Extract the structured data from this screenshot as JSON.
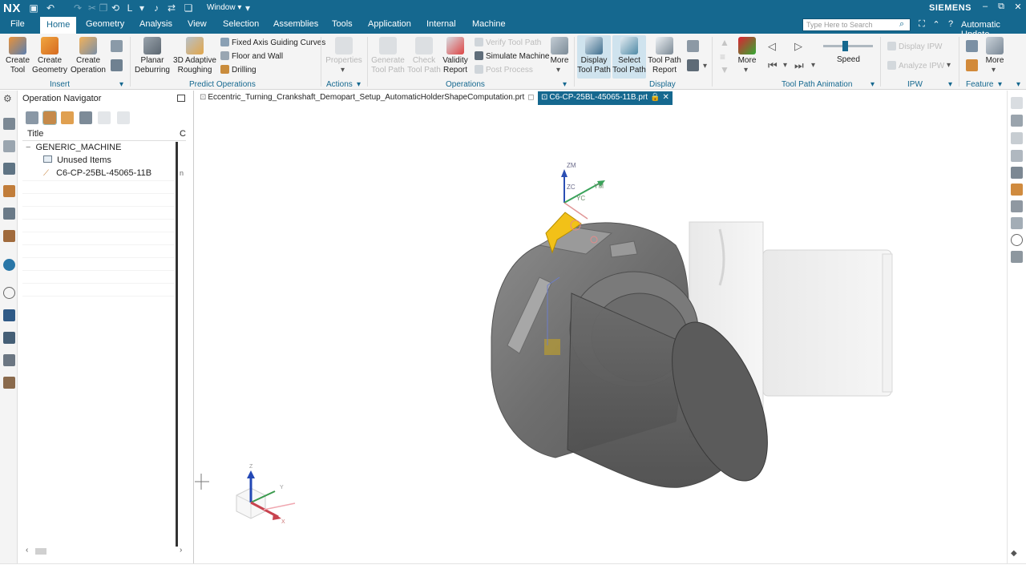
{
  "app": {
    "logo": "NX",
    "brand": "SIEMENS",
    "window_menu": "Window ▾",
    "auto_update": "Automatic Update"
  },
  "menu": {
    "items": [
      "File",
      "Home",
      "Geometry",
      "Analysis",
      "View",
      "Selection",
      "Assemblies",
      "Tools",
      "Application",
      "Internal",
      "Machine"
    ],
    "active": "Home"
  },
  "search": {
    "placeholder": "Type Here to Search"
  },
  "ribbon": {
    "insert": {
      "create_tool": "Create\nTool",
      "create_geometry": "Create\nGeometry",
      "create_operation": "Create\nOperation",
      "group": "Insert"
    },
    "predict": {
      "planar": "Planar\nDeburring",
      "adaptive": "3D Adaptive\nRoughing",
      "fixed_axis": "Fixed Axis Guiding Curves",
      "floor_wall": "Floor and Wall",
      "drilling": "Drilling",
      "group": "Predict Operations"
    },
    "actions": {
      "properties": "Properties",
      "group": "Actions"
    },
    "operations": {
      "generate": "Generate\nTool Path",
      "check": "Check\nTool Path",
      "validity": "Validity\nReport",
      "verify": "Verify Tool Path",
      "simulate": "Simulate Machine",
      "post": "Post Process",
      "more": "More",
      "group": "Operations"
    },
    "display": {
      "display_tp": "Display\nTool Path",
      "select_tp": "Select\nTool Path",
      "report": "Tool Path\nReport",
      "group": "Display"
    },
    "animation": {
      "more": "More",
      "speed": "Speed",
      "group": "Tool Path Animation"
    },
    "ipw": {
      "display": "Display IPW",
      "analyze": "Analyze IPW",
      "group": "IPW"
    },
    "feature": {
      "more": "More",
      "group": "Feature"
    }
  },
  "navigator": {
    "title": "Operation Navigator",
    "col_title": "Title",
    "col_c": "C",
    "tree": [
      {
        "label": "GENERIC_MACHINE",
        "indent": 0,
        "toggle": "−"
      },
      {
        "label": "Unused Items",
        "indent": 1,
        "toggle": ""
      },
      {
        "label": "C6-CP-25BL-45065-11B",
        "indent": 1,
        "toggle": "",
        "c": "n"
      }
    ]
  },
  "tabs": [
    {
      "label": "Eccentric_Turning_Crankshaft_Demopart_Setup_AutomaticHolderShapeComputation.prt",
      "active": false
    },
    {
      "label": "C6-CP-25BL-45065-11B.prt",
      "active": true
    }
  ],
  "csys": {
    "zm": "ZM",
    "zc": "ZC",
    "yc": "YC",
    "ym": "YM"
  },
  "triad": {
    "z": "Z",
    "y": "Y",
    "x": "X"
  }
}
